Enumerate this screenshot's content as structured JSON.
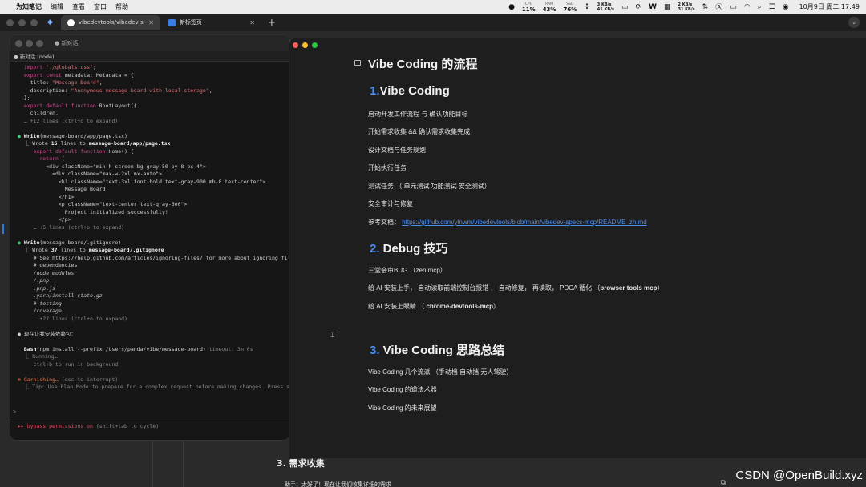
{
  "menubar": {
    "app_name": "为知笔记",
    "menus": [
      "编辑",
      "查看",
      "窗口",
      "帮助"
    ],
    "stats": [
      {
        "label": "CPU",
        "value": "11%"
      },
      {
        "label": "RAM",
        "value": "43%"
      },
      {
        "label": "SSD",
        "value": "76%"
      }
    ],
    "net1": [
      "3 KB/s",
      "41 KB/s"
    ],
    "net2": [
      "2 KB/s",
      "31 KB/s"
    ],
    "clock": "10月9日 周二 17:49"
  },
  "browser": {
    "tabs": [
      {
        "label": "vibedevtools/vibedev-specs-",
        "active": true
      },
      {
        "label": "新标签页",
        "active": false
      }
    ],
    "new_tab": "+"
  },
  "terminal": {
    "title": "● 新对话",
    "subtab": "● 新对话 (node)",
    "lines": [
      [
        [
          "k",
          "  import "
        ],
        [
          "s",
          "\"./globals.css\""
        ],
        [
          "",
          "; "
        ]
      ],
      [
        [
          "k",
          "  export const "
        ],
        [
          "",
          "metadata: Metadata = {"
        ]
      ],
      [
        [
          "",
          "    title: "
        ],
        [
          "s",
          "\"Message Board\""
        ],
        [
          "",
          ","
        ]
      ],
      [
        [
          "",
          "    description: "
        ],
        [
          "s",
          "\"Anonymous message board with local storage\""
        ],
        [
          "",
          ","
        ]
      ],
      [
        [
          "",
          "  };"
        ]
      ],
      [
        [
          "k",
          "  export default function "
        ],
        [
          "",
          "RootLayout({"
        ]
      ],
      [
        [
          "",
          "    children,"
        ]
      ],
      [
        [
          "g",
          "  … +12 lines (ctrl+o to expand)"
        ]
      ],
      [
        [
          "",
          ""
        ]
      ],
      [
        [
          "grn",
          "●"
        ],
        [
          "w",
          " Write"
        ],
        [
          "",
          "(message-board/app/page.tsx)"
        ]
      ],
      [
        [
          "",
          "  ⎿ Wrote "
        ],
        [
          "w",
          "15"
        ],
        [
          "",
          " lines to "
        ],
        [
          "w",
          "message-board/app/page.tsx"
        ]
      ],
      [
        [
          "k",
          "     export default function "
        ],
        [
          "",
          "Home() {"
        ]
      ],
      [
        [
          "k",
          "       return "
        ],
        [
          "",
          "("
        ]
      ],
      [
        [
          "",
          "         <div className=\"min-h-screen bg-gray-50 py-8 px-4\">"
        ]
      ],
      [
        [
          "",
          "           <div className=\"max-w-2xl mx-auto\">"
        ]
      ],
      [
        [
          "",
          "             <h1 className=\"text-3xl font-bold text-gray-900 mb-8 text-center\">"
        ]
      ],
      [
        [
          "",
          "               Message Board"
        ]
      ],
      [
        [
          "",
          "             </h1>"
        ]
      ],
      [
        [
          "",
          "             <p className=\"text-center text-gray-600\">"
        ]
      ],
      [
        [
          "",
          "               Project initialized successfully!"
        ]
      ],
      [
        [
          "",
          "             </p>"
        ]
      ],
      [
        [
          "g",
          "     … +5 lines (ctrl+o to expand)"
        ]
      ],
      [
        [
          "",
          ""
        ]
      ],
      [
        [
          "grn",
          "●"
        ],
        [
          "w",
          " Write"
        ],
        [
          "",
          "(message-board/.gitignore)"
        ]
      ],
      [
        [
          "",
          "  ⎿ Wrote "
        ],
        [
          "w",
          "37"
        ],
        [
          "",
          " lines to "
        ],
        [
          "w",
          "message-board/.gitignore"
        ]
      ],
      [
        [
          "",
          "     # See https://help.github.com/articles/ignoring-files/ for more about ignoring fil"
        ]
      ],
      [
        [
          "",
          "     # dependencies"
        ]
      ],
      [
        [
          "i",
          "     /node_modules"
        ]
      ],
      [
        [
          "i",
          "     /.pnp"
        ]
      ],
      [
        [
          "i",
          "     .pnp.js"
        ]
      ],
      [
        [
          "i",
          "     .yarn/install-state.gz"
        ]
      ],
      [
        [
          "i",
          "     # testing"
        ]
      ],
      [
        [
          "i",
          "     /coverage"
        ]
      ],
      [
        [
          "g",
          "     … +27 lines (ctrl+o to expand)"
        ]
      ],
      [
        [
          "",
          ""
        ]
      ],
      [
        [
          "",
          "● 现在让我安装依赖包："
        ]
      ],
      [
        [
          "",
          ""
        ]
      ],
      [
        [
          "w",
          "  Bash"
        ],
        [
          "",
          "(npm install --prefix /Users/panda/vibe/message-board) "
        ],
        [
          "g",
          "timeout: 3m 0s"
        ]
      ],
      [
        [
          "g",
          "  ⎿ Running…"
        ]
      ],
      [
        [
          "g",
          "     ctrl+b to run in background"
        ]
      ],
      [
        [
          "",
          ""
        ]
      ],
      [
        [
          "org",
          "✻ Garnishing…"
        ],
        [
          "g",
          " (esc to interrupt)"
        ]
      ],
      [
        [
          "g",
          "  ⎿ Tip: Use Plan Mode to prepare for a complex request before making changes. Press sh"
        ]
      ]
    ],
    "input_prompt": ">",
    "perm_prefix": "▸▸ bypass permissions on",
    "perm_hint": " (shift+tab to cycle)"
  },
  "doc": {
    "title": "Vibe Coding 的流程",
    "section1": {
      "num": "1.",
      "title": "Vibe Coding"
    },
    "s1_items": [
      "启动开发工作流程 与 确认功能目标",
      "开始需求收集 && 确认需求收集完成",
      "设计文档与任务规划",
      "开始执行任务",
      "测试任务 （ 单元测试 功能测试  安全测试）",
      "安全审计与修复"
    ],
    "ref_label": " 参考文档： ",
    "ref_url": "https://github.com/yinwm/vibedevtools/blob/main/vibedev-specs-mcp/README_zh.md",
    "section2": {
      "num": "2.",
      "title": " Debug 技巧"
    },
    "s2_item1": "三堂会审BUG  （zen mcp）",
    "s2_item2_pre": "给 AI 安装上手， 自动读取前端控制台报错 ， 自动修复， 再读取， PDCA 循化 （",
    "s2_item2_bold": "browser tools mcp",
    "s2_item2_post": "）",
    "s2_item3_pre": "给 AI 安装上眼睛  （ ",
    "s2_item3_bold": "chrome-devtools-mcp",
    "s2_item3_post": "）",
    "section3": {
      "num": "3.",
      "title": " Vibe Coding 思路总结"
    },
    "s3_items": [
      " Vibe Coding 几个流派  （手动档  自动挡 无人驾驶）",
      " Vibe Coding 的道法术器",
      "Vibe Coding 的未来展望"
    ]
  },
  "background": {
    "heading": "3. 需求收集",
    "message": "助手：太好了！现在让我们收集详细的需求"
  },
  "watermark": "CSDN @OpenBuild.xyz"
}
